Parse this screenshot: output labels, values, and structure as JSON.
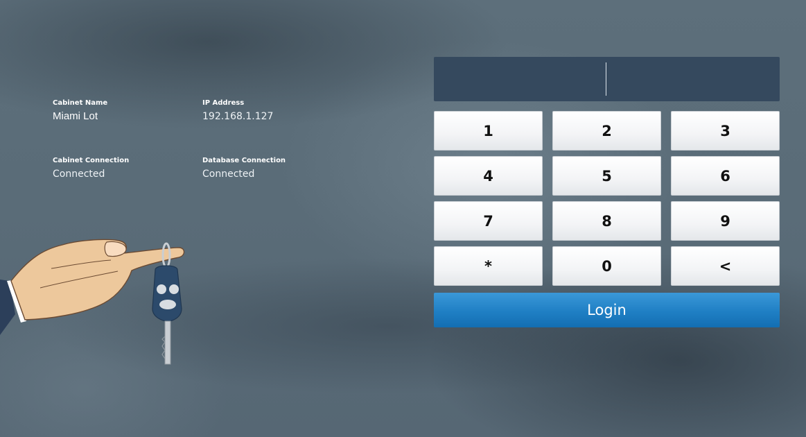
{
  "info": {
    "cabinet_name_label": "Cabinet Name",
    "cabinet_name_value": "Miami Lot",
    "ip_address_label": "IP Address",
    "ip_address_value": "192.168.1.127",
    "cabinet_connection_label": "Cabinet Connection",
    "cabinet_connection_value": "Connected",
    "database_connection_label": "Database Connection",
    "database_connection_value": "Connected"
  },
  "pin": {
    "value": ""
  },
  "keypad": {
    "keys": [
      "1",
      "2",
      "3",
      "4",
      "5",
      "6",
      "7",
      "8",
      "9",
      "*",
      "0",
      "<"
    ]
  },
  "login_label": "Login",
  "colors": {
    "display_bg": "#35495e",
    "login_blue": "#1f7fc4",
    "background": "#5b6d7a"
  },
  "icons": {
    "illustration": "hand-holding-car-key-icon"
  }
}
